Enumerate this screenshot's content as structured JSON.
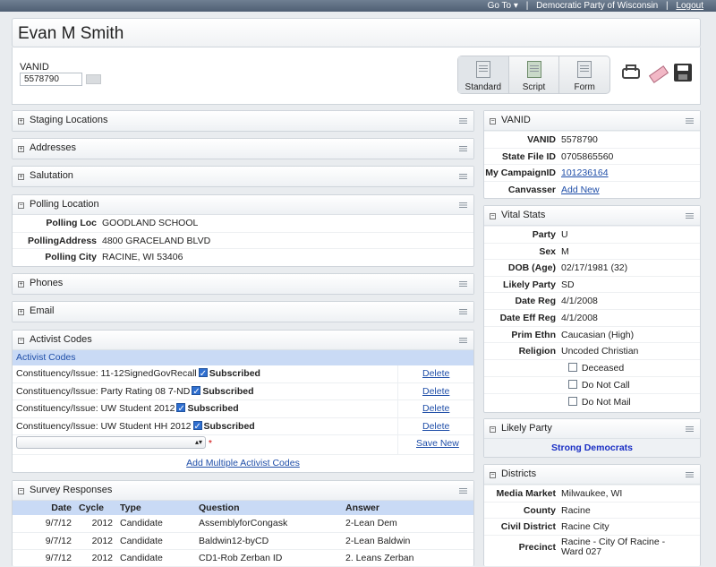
{
  "topbar": {
    "goto": "Go To ▾",
    "org": "Democratic Party of Wisconsin",
    "logout": "Logout",
    "sep": "|"
  },
  "page": {
    "title": "Evan M Smith"
  },
  "vanid": {
    "label": "VANID",
    "value": "5578790"
  },
  "modes": [
    "Standard",
    "Script",
    "Form"
  ],
  "left_collapsed": [
    "Staging Locations",
    "Addresses",
    "Salutation"
  ],
  "polling": {
    "title": "Polling Location",
    "rows": [
      {
        "k": "Polling Loc",
        "v": "GOODLAND SCHOOL"
      },
      {
        "k": "PollingAddress",
        "v": "4800 GRACELAND BLVD"
      },
      {
        "k": "Polling City",
        "v": "RACINE, WI 53406"
      }
    ]
  },
  "phones": "Phones",
  "email": "Email",
  "activist": {
    "title": "Activist Codes",
    "subhead": "Activist Codes",
    "rows": [
      {
        "label": "Constituency/Issue: 11-12SignedGovRecall",
        "status": "Subscribed",
        "action": "Delete"
      },
      {
        "label": "Constituency/Issue: Party Rating 08 7-ND",
        "status": "Subscribed",
        "action": "Delete"
      },
      {
        "label": "Constituency/Issue: UW Student 2012",
        "status": "Subscribed",
        "action": "Delete"
      },
      {
        "label": "Constituency/Issue: UW Student HH 2012",
        "status": "Subscribed",
        "action": "Delete"
      }
    ],
    "required_mark": "*",
    "save": "Save New",
    "add_multiple": "Add Multiple Activist Codes"
  },
  "survey": {
    "title": "Survey Responses",
    "headers": [
      "Date",
      "Cycle",
      "Type",
      "Question",
      "Answer"
    ],
    "rows": [
      [
        "9/7/12",
        "2012",
        "Candidate",
        "AssemblyforCongask",
        "2-Lean Dem"
      ],
      [
        "9/7/12",
        "2012",
        "Candidate",
        "Baldwin12-byCD",
        "2-Lean Baldwin"
      ],
      [
        "9/7/12",
        "2012",
        "Candidate",
        "CD1-Rob Zerban ID",
        "2. Leans Zerban"
      ]
    ]
  },
  "vanid_panel": {
    "title": "VANID",
    "rows": [
      {
        "k": "VANID",
        "v": "5578790"
      },
      {
        "k": "State File ID",
        "v": "0705865560"
      },
      {
        "k": "My CampaignID",
        "v": "101236164"
      },
      {
        "k": "Canvasser",
        "v": "Add New"
      }
    ]
  },
  "vital": {
    "title": "Vital Stats",
    "rows": [
      {
        "k": "Party",
        "v": "U"
      },
      {
        "k": "Sex",
        "v": "M"
      },
      {
        "k": "DOB (Age)",
        "v": "02/17/1981 (32)"
      },
      {
        "k": "Likely Party",
        "v": "SD"
      },
      {
        "k": "Date Reg",
        "v": "4/1/2008"
      },
      {
        "k": "Date Eff Reg",
        "v": "4/1/2008"
      },
      {
        "k": "Prim Ethn",
        "v": "Caucasian (High)"
      },
      {
        "k": "Religion",
        "v": "Uncoded Christian"
      }
    ],
    "checks": [
      "Deceased",
      "Do Not Call",
      "Do Not Mail"
    ]
  },
  "likely_party": {
    "title": "Likely Party",
    "value": "Strong Democrats"
  },
  "districts": {
    "title": "Districts",
    "rows": [
      {
        "k": "Media Market",
        "v": "Milwaukee, WI"
      },
      {
        "k": "County",
        "v": "Racine"
      },
      {
        "k": "Civil District",
        "v": "Racine City"
      },
      {
        "k": "Precinct",
        "v": "Racine - City Of Racine - Ward 027"
      }
    ]
  }
}
